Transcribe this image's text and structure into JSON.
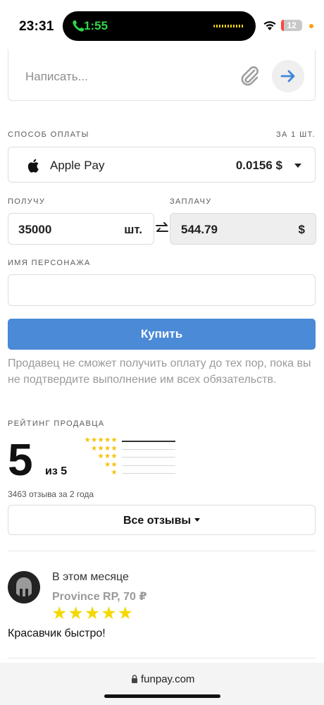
{
  "status_bar": {
    "time": "23:31",
    "call_timer": "1:55",
    "battery": "12",
    "battery_level": 0.12
  },
  "message": {
    "placeholder": "Написать..."
  },
  "payment": {
    "label": "СПОСОБ ОПЛАТЫ",
    "per_unit_label": "ЗА 1 ШТ.",
    "method": "Apple Pay",
    "price": "0.0156 $"
  },
  "receive": {
    "label": "ПОЛУЧУ",
    "value": "35000",
    "unit": "шт."
  },
  "pay": {
    "label": "ЗАПЛАЧУ",
    "value": "544.79",
    "currency": "$"
  },
  "character": {
    "label": "ИМЯ ПЕРСОНАЖА",
    "value": ""
  },
  "buy_button": "Купить",
  "note": "Продавец не сможет получить оплату до тех пор, пока вы не подтвердите выполнение им всех обязательств.",
  "rating": {
    "label": "РЕЙТИНГ ПРОДАВЦА",
    "score": "5",
    "out_of": "из 5",
    "distribution": [
      {
        "stars": "★★★★★",
        "share": 1.0
      },
      {
        "stars": "★★★★",
        "share": 0.0
      },
      {
        "stars": "★★★",
        "share": 0.0
      },
      {
        "stars": "★★",
        "share": 0.0
      },
      {
        "stars": "★",
        "share": 0.0
      }
    ],
    "reviews_count": "3463 отзыва за 2 года",
    "all_reviews": "Все отзывы"
  },
  "review": {
    "period": "В этом месяце",
    "item": "Province RP, 70 ₽",
    "stars": "★★★★★",
    "text": "Красавчик быстро!"
  },
  "browser": {
    "url": "funpay.com"
  },
  "colors": {
    "accent": "#4a8ad6",
    "star": "#f5d800",
    "call_green": "#32d74b"
  }
}
